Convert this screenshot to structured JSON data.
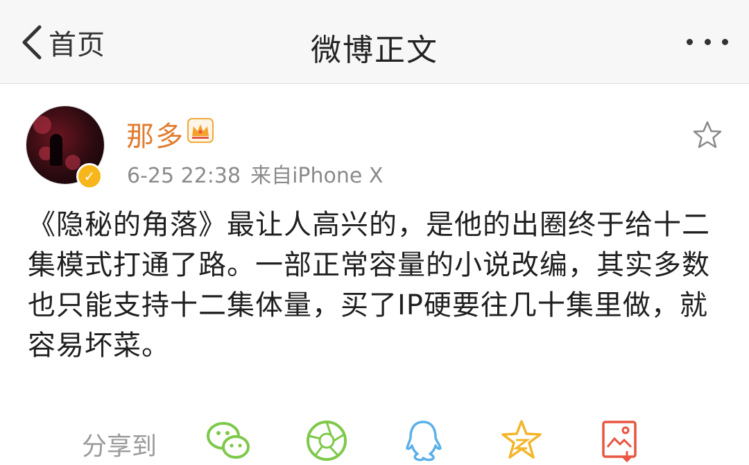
{
  "header": {
    "back_label": "首页",
    "title": "微博正文"
  },
  "post": {
    "username": "那多",
    "time": "6-25 22:38",
    "source": "来自iPhone X",
    "body": "《隐秘的角落》最让人高兴的，是他的出圈终于给十二集模式打通了路。一部正常容量的小说改编，其实多数也只能支持十二集体量，买了IP硬要往几十集里做，就容易坏菜。"
  },
  "share": {
    "label": "分享到",
    "targets": [
      "wechat-icon",
      "moments-icon",
      "qq-icon",
      "qzone-icon",
      "save-image-icon"
    ]
  },
  "colors": {
    "username": "#e07d30",
    "verified_badge": "#f6b61c",
    "share_green": "#7ec84a",
    "share_blue": "#5ab0e8",
    "share_gold": "#f3b52a",
    "share_red": "#e8553f"
  }
}
